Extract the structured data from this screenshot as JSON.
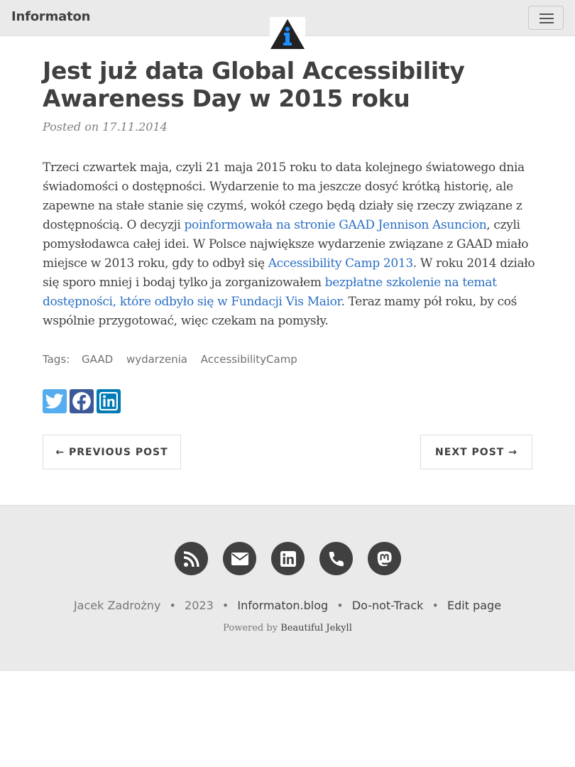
{
  "navbar": {
    "brand": "Informaton",
    "menu_icon": "hamburger-menu-icon",
    "logo": {
      "icon": "informaton-logo",
      "letter": "i",
      "color_dark": "#222222",
      "color_accent": "#1e90ff"
    }
  },
  "post": {
    "title": "Jest już data Global Accessibility Awareness Day w 2015 roku",
    "meta": "Posted on 17.11.2014",
    "body": {
      "t1": "Trzeci czwartek maja, czyli 21 maja 2015 roku to data kolejnego światowego dnia świadomości o dostępności. Wydarzenie to ma jeszcze dosyć krótką historię, ale zapewne na stałe stanie się czymś, wokół czego będą działy się rzeczy związane z dostępnością. O decyzji ",
      "link1": "poinformowała na stronie GAAD Jennison Asuncion",
      "t2": ", czyli pomysłodawca całej idei. W Polsce największe wydarzenie związane z GAAD miało miejsce w 2013 roku, gdy to odbył się ",
      "link2": "Accessibility Camp 2013",
      "t3": ". W roku 2014 działo się sporo mniej i bodaj tylko ja zorganizowałem ",
      "link3": "bezpłatne szkolenie na temat dostępności, które odbyło się w Fundacji Vis Maior",
      "t4": ". Teraz mamy pół roku, by coś wspólnie przygotować, więc czekam na pomysły."
    },
    "tags_label": "Tags:",
    "tags": [
      "GAAD",
      "wydarzenia",
      "AccessibilityCamp"
    ]
  },
  "share": {
    "twitter_icon": "twitter-icon",
    "facebook_icon": "facebook-icon",
    "linkedin_icon": "linkedin-icon",
    "colors": {
      "twitter": "#55acee",
      "facebook": "#3b5998",
      "linkedin": "#007bb5"
    }
  },
  "pager": {
    "previous": "← PREVIOUS POST",
    "next": "NEXT POST →"
  },
  "footer": {
    "icons": [
      "rss-icon",
      "envelope-icon",
      "linkedin-icon",
      "phone-icon",
      "mastodon-icon"
    ],
    "author": "Jacek Zadrożny",
    "year": "2023",
    "site": "Informaton.blog",
    "dnt": "Do-not-Track",
    "edit": "Edit page",
    "powered_prefix": "Powered by",
    "powered_link": "Beautiful Jekyll",
    "bullet": "•"
  }
}
